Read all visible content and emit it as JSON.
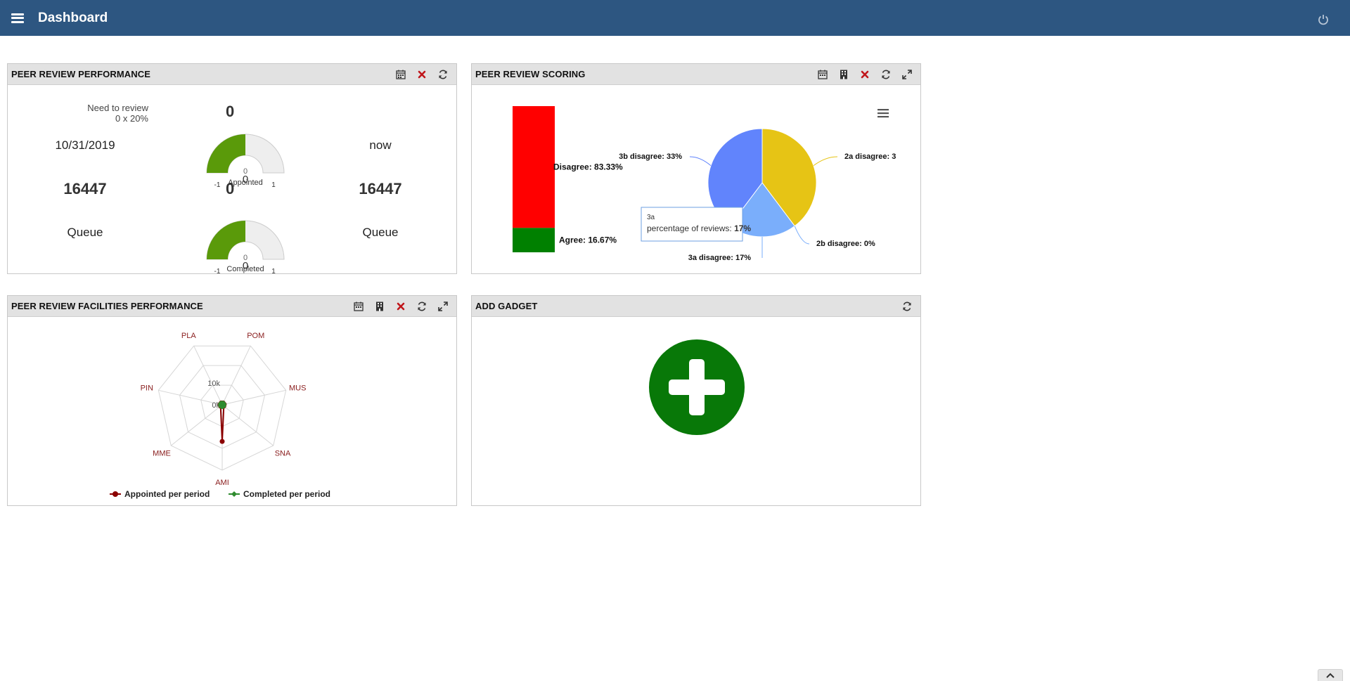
{
  "header": {
    "title": "Dashboard"
  },
  "colors": {
    "topbar": "#2d5681",
    "gauge_green": "#5a9a0a",
    "disagree_red": "#ff0000",
    "agree_green": "#008000",
    "pie_yellow": "#e6c415",
    "pie_blue": "#6184fc",
    "pie_lightblue": "#7aaefb",
    "add_green": "#087808",
    "radar_red": "#8b0000",
    "radar_green": "#2e8b2e"
  },
  "performance": {
    "title": "PEER REVIEW PERFORMANCE",
    "need_label": "Need to review",
    "need_sub": "0 x 20%",
    "need_value": "0",
    "date_left": "10/31/2019",
    "date_right": "now",
    "count_left": "16447",
    "count_mid": "0",
    "count_right": "16447",
    "queue_left": "Queue",
    "queue_right": "Queue",
    "gauges": [
      {
        "name": "Appointed",
        "value": 0,
        "value_label": "0",
        "inner_label": "0",
        "min": "-1",
        "max": "1"
      },
      {
        "name": "Completed",
        "value": 0,
        "value_label": "0",
        "inner_label": "0",
        "min": "-1",
        "max": "1"
      }
    ]
  },
  "scoring": {
    "title": "PEER REVIEW SCORING",
    "tooltip": {
      "name": "3a",
      "label": "percentage of reviews:",
      "value": "17%"
    }
  },
  "facilities": {
    "title": "PEER REVIEW FACILITIES PERFORMANCE"
  },
  "add_gadget": {
    "title": "ADD GADGET"
  },
  "chart_data": [
    {
      "type": "bar",
      "categories": [
        "Agree",
        "Disagree"
      ],
      "values": [
        16.67,
        83.33
      ],
      "labels": [
        "Agree: 16.67%",
        "Disagree: 83.33%"
      ],
      "stacked": true
    },
    {
      "type": "pie",
      "categories": [
        "2a disagree",
        "2b disagree",
        "3a disagree",
        "3b disagree"
      ],
      "values": [
        33,
        0,
        17,
        33
      ],
      "labels": [
        "2a disagree: 3",
        "2b disagree: 0%",
        "3a disagree: 17%",
        "3b disagree: 33%"
      ]
    },
    {
      "type": "line",
      "polar": true,
      "categories": [
        "POM",
        "MUS",
        "SNA",
        "AMI",
        "MME",
        "PIN",
        "PLA"
      ],
      "tick_labels": [
        "0k",
        "10k"
      ],
      "series": [
        {
          "name": "Appointed per period",
          "values": [
            150,
            150,
            150,
            16000,
            150,
            150,
            150
          ]
        },
        {
          "name": "Completed per period",
          "values": [
            0,
            0,
            0,
            0,
            0,
            0,
            0
          ]
        }
      ],
      "ylim": [
        0,
        30000
      ]
    }
  ]
}
